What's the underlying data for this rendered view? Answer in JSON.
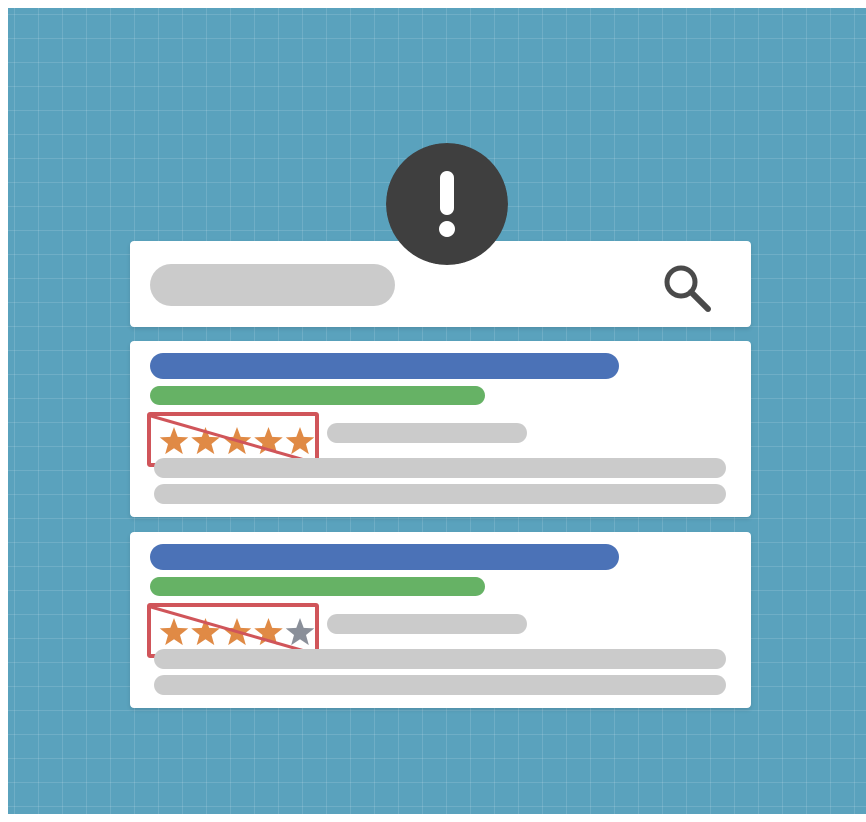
{
  "icons": {
    "alert": "exclamation-icon",
    "search": "search-icon",
    "star": "star-icon"
  },
  "colors": {
    "background": "#5aa2bd",
    "alert_badge": "#3f3f3f",
    "title_bar": "#4b72b7",
    "url_bar": "#66b265",
    "placeholder_gray": "#cbcbcb",
    "star_filled": "#e08a45",
    "star_empty": "#8a8f99",
    "strike_red": "#d0555a"
  },
  "results": [
    {
      "rating": 5,
      "rating_max": 5
    },
    {
      "rating": 4,
      "rating_max": 5
    }
  ]
}
